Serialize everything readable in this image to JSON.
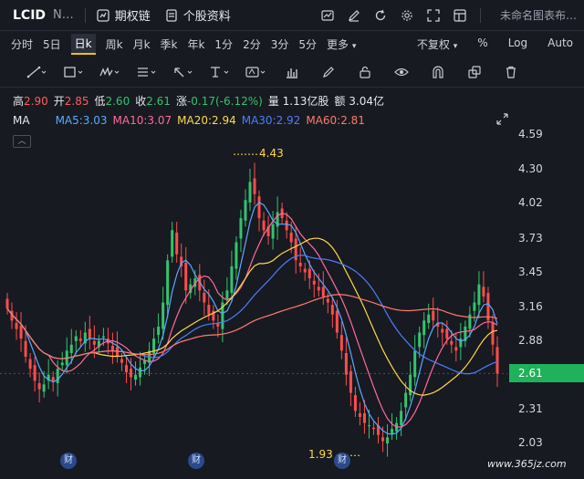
{
  "header": {
    "symbol": "LCID",
    "symbol_name": "N…",
    "buttons": [
      {
        "label": "期权链",
        "icon": "options-chain-icon"
      },
      {
        "label": "个股资料",
        "icon": "stock-profile-icon"
      }
    ],
    "right_icons": [
      "chart-type-icon",
      "edit-icon",
      "refresh-icon",
      "settings-icon",
      "fullscreen-icon",
      "layout-icon"
    ],
    "layout_name": "未命名图表布…"
  },
  "timeframes": {
    "items": [
      "分时",
      "5日",
      "日k",
      "周k",
      "月k",
      "季k",
      "年k",
      "1分",
      "2分",
      "3分",
      "5分",
      "更多"
    ],
    "active": "日k",
    "right": [
      "不复权",
      "%",
      "Log",
      "Auto"
    ]
  },
  "tools": [
    "trend-line-tool-icon",
    "rectangle-tool-icon",
    "wave-tool-icon",
    "fibonacci-tool-icon",
    "arrow-tool-icon",
    "text-tool-icon",
    "label-tool-icon",
    "measure-tool-icon",
    "pen-tool-icon",
    "lock-icon",
    "eye-icon",
    "magnet-icon",
    "layers-icon",
    "trash-icon"
  ],
  "quote": {
    "high_label": "高",
    "high": "2.90",
    "open_label": "开",
    "open": "2.85",
    "low_label": "低",
    "low": "2.60",
    "close_label": "收",
    "close": "2.61",
    "change_label": "涨",
    "change": "-0.17(-6.12%)",
    "volume_label": "量",
    "volume": "1.13亿股",
    "amount_label": "额",
    "amount": "3.04亿"
  },
  "ma": {
    "label": "MA",
    "items": [
      {
        "label": "MA5:3.03",
        "color": "#5aa9ff"
      },
      {
        "label": "MA10:3.07",
        "color": "#ff6b9a"
      },
      {
        "label": "MA20:2.94",
        "color": "#ffd84a"
      },
      {
        "label": "MA30:2.92",
        "color": "#4c7dff"
      },
      {
        "label": "MA60:2.81",
        "color": "#ff7a6b"
      }
    ]
  },
  "chart_data": {
    "type": "candlestick",
    "ylim": [
      1.93,
      4.59
    ],
    "y_ticks": [
      "4.59",
      "4.30",
      "4.02",
      "3.73",
      "3.45",
      "3.16",
      "2.88",
      "2.61",
      "2.31",
      "2.03"
    ],
    "current_price": "2.61",
    "annotations": [
      {
        "label": "4.43",
        "type": "high"
      },
      {
        "label": "1.93",
        "type": "low"
      }
    ],
    "event_markers": [
      "财",
      "财",
      "财"
    ],
    "closes": [
      3.15,
      3.05,
      2.98,
      2.9,
      2.75,
      2.65,
      2.55,
      2.48,
      2.52,
      2.6,
      2.55,
      2.65,
      2.7,
      2.8,
      2.85,
      2.92,
      2.88,
      2.95,
      2.9,
      2.85,
      2.88,
      2.92,
      2.86,
      2.8,
      2.75,
      2.7,
      2.62,
      2.58,
      2.6,
      2.66,
      2.72,
      2.8,
      2.9,
      3.0,
      3.2,
      3.55,
      3.8,
      3.6,
      3.5,
      3.3,
      3.35,
      3.4,
      3.3,
      3.2,
      3.1,
      3.05,
      3.0,
      3.2,
      3.3,
      3.5,
      3.7,
      3.9,
      4.05,
      4.2,
      4.1,
      3.9,
      3.8,
      3.75,
      3.85,
      3.95,
      3.9,
      3.8,
      3.7,
      3.55,
      3.5,
      3.45,
      3.4,
      3.35,
      3.3,
      3.25,
      3.2,
      3.1,
      2.95,
      2.8,
      2.6,
      2.45,
      2.3,
      2.25,
      2.2,
      2.18,
      2.15,
      2.1,
      2.05,
      2.08,
      2.15,
      2.2,
      2.3,
      2.45,
      2.6,
      2.8,
      2.95,
      3.05,
      3.1,
      3.05,
      3.0,
      2.95,
      2.9,
      2.85,
      2.8,
      2.9,
      3.0,
      3.1,
      3.2,
      3.35,
      3.25,
      3.05,
      2.85,
      2.61
    ]
  },
  "watermark": "www.365jz.com"
}
